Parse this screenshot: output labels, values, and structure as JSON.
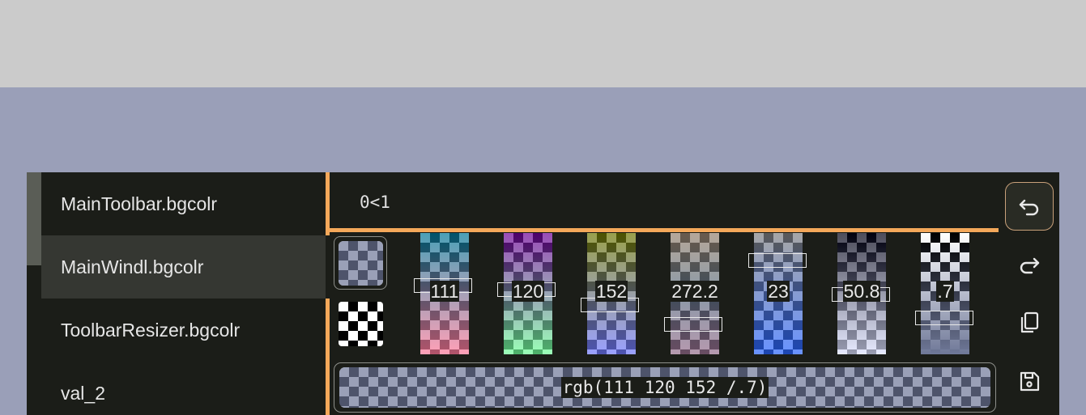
{
  "list": {
    "items": [
      {
        "label": "MainToolbar.bgcolr"
      },
      {
        "label": "MainWindl.bgcolr"
      },
      {
        "label": "ToolbarResizer.bgcolr"
      },
      {
        "label": "val_2"
      }
    ],
    "selected_index": 1
  },
  "editor": {
    "expression": "0<1"
  },
  "channels": [
    {
      "value": "111",
      "level": 0.435
    },
    {
      "value": "120",
      "level": 0.47
    },
    {
      "value": "152",
      "level": 0.596
    },
    {
      "value": "272.2",
      "level": 0.756
    },
    {
      "value": "23",
      "level": 0.23
    },
    {
      "value": "50.8",
      "level": 0.508
    },
    {
      "value": ".7",
      "level": 0.7
    }
  ],
  "result": {
    "text": "rgb(111 120 152 /.7)"
  },
  "colors": {
    "accent": "#f4a85a",
    "panel_bg": "#1b1d18",
    "selected_bg": "#353732",
    "page_bg": "#9a9fb8",
    "top_bg": "#cbcbcb",
    "current_color": "rgba(111,120,152,0.7)"
  },
  "toolbar": {
    "icons": [
      "undo-icon",
      "redo-icon",
      "copy-icon",
      "save-icon"
    ]
  }
}
